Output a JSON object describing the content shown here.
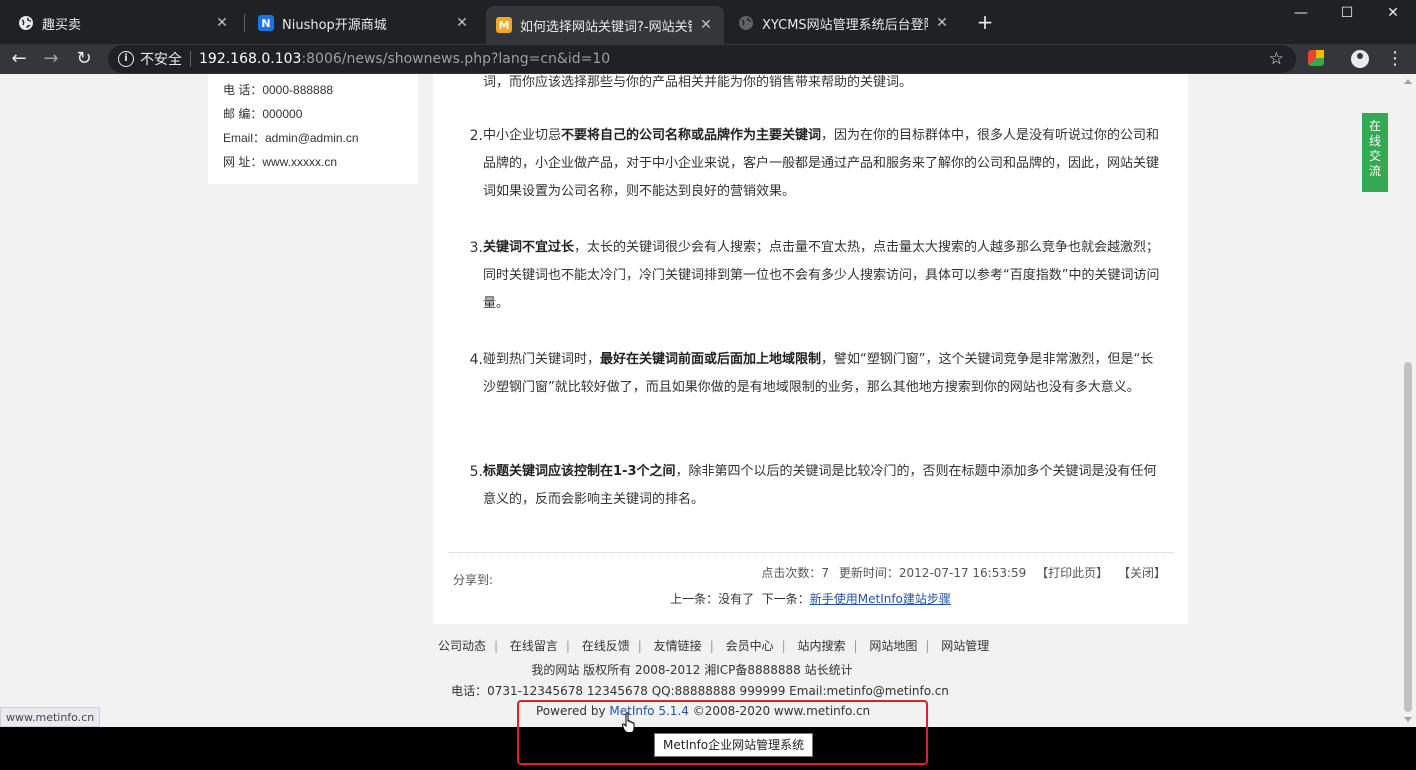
{
  "tabs": [
    {
      "title": "趣买卖",
      "icon": "globe-icon",
      "active": false
    },
    {
      "title": "Niushop开源商城",
      "icon": "niushop-icon",
      "active": false
    },
    {
      "title": "如何选择网站关键词?-网站关键词",
      "icon": "metinfo-icon",
      "active": true
    },
    {
      "title": "XYCMS网站管理系统后台登陆中心",
      "icon": "globe-icon",
      "active": false
    }
  ],
  "toolbar": {
    "insecure_label": "不安全",
    "url_host": "192.168.0.103",
    "url_path": ":8006/news/shownews.php?lang=cn&id=10"
  },
  "contact": {
    "phone": "电  话：0000-888888",
    "postcode": "邮  编：000000",
    "email": "Email：admin@admin.cn",
    "site": "网  址：www.xxxxx.cn"
  },
  "article": {
    "cut_line": "词，而你应该选择那些与你的产品相关并能为你的销售带来帮助的关键词。",
    "items": [
      {
        "num": "2.",
        "pre": "中小企业切忌",
        "bold": "不要将自己的公司名称或品牌作为主要关键词",
        "post": "，因为在你的目标群体中，很多人是没有听说过你的公司和品牌的，小企业做产品，对于中小企业来说，客户一般都是通过产品和服务来了解你的公司和品牌的，因此，网站关键词如果设置为公司名称，则不能达到良好的营销效果。"
      },
      {
        "num": "3.",
        "pre": "",
        "bold": "关键词不宜过长",
        "post": "，太长的关键词很少会有人搜索；点击量不宜太热，点击量太大搜索的人越多那么竞争也就会越激烈；同时关键词也不能太冷门，冷门关键词排到第一位也不会有多少人搜索访问，具体可以参考“百度指数”中的关键词访问量。"
      },
      {
        "num": "4.",
        "pre": "碰到热门关键词时，",
        "bold": "最好在关键词前面或后面加上地域限制",
        "post": "，譬如“塑钢门窗”，这个关键词竞争是非常激烈，但是“长沙塑钢门窗”就比较好做了，而且如果你做的是有地域限制的业务，那么其他地方搜索到你的网站也没有多大意义。"
      },
      {
        "num": "5.",
        "pre": "",
        "bold": "标题关键词应该控制在1-3个之间",
        "post": "，除非第四个以后的关键词是比较冷门的，否则在标题中添加多个关键词是没有任何意义的，反而会影响主关键词的排名。"
      }
    ],
    "share_label": "分享到:",
    "hits": "点击次数：7",
    "updated": "更新时间：2012-07-17 16:53:59",
    "print_label": "【打印此页】",
    "close_label": "【关闭】",
    "prev_label": "上一条：没有了",
    "next_prefix": "下一条：",
    "next_link": "新手使用MetInfo建站步骤"
  },
  "footer": {
    "links": [
      "公司动态",
      "在线留言",
      "在线反馈",
      "友情链接",
      "会员中心",
      "站内搜索",
      "网站地图",
      "网站管理"
    ],
    "copyright": "我的网站 版权所有 2008-2012 湘ICP备8888888 站长统计",
    "contact": "电话：0731-12345678 12345678 QQ:88888888 999999 Email:metinfo@metinfo.cn",
    "powered_prefix": "Powered by ",
    "powered_link": "MetInfo 5.1.4",
    "powered_suffix": " ©2008-2020  www.metinfo.cn"
  },
  "chat_widget": "在线交流",
  "status_url": "www.metinfo.cn",
  "tooltip": "MetInfo企业网站管理系统",
  "colors": {
    "highlight": "#e02020",
    "chat": "#34a853",
    "link": "#2255aa"
  }
}
